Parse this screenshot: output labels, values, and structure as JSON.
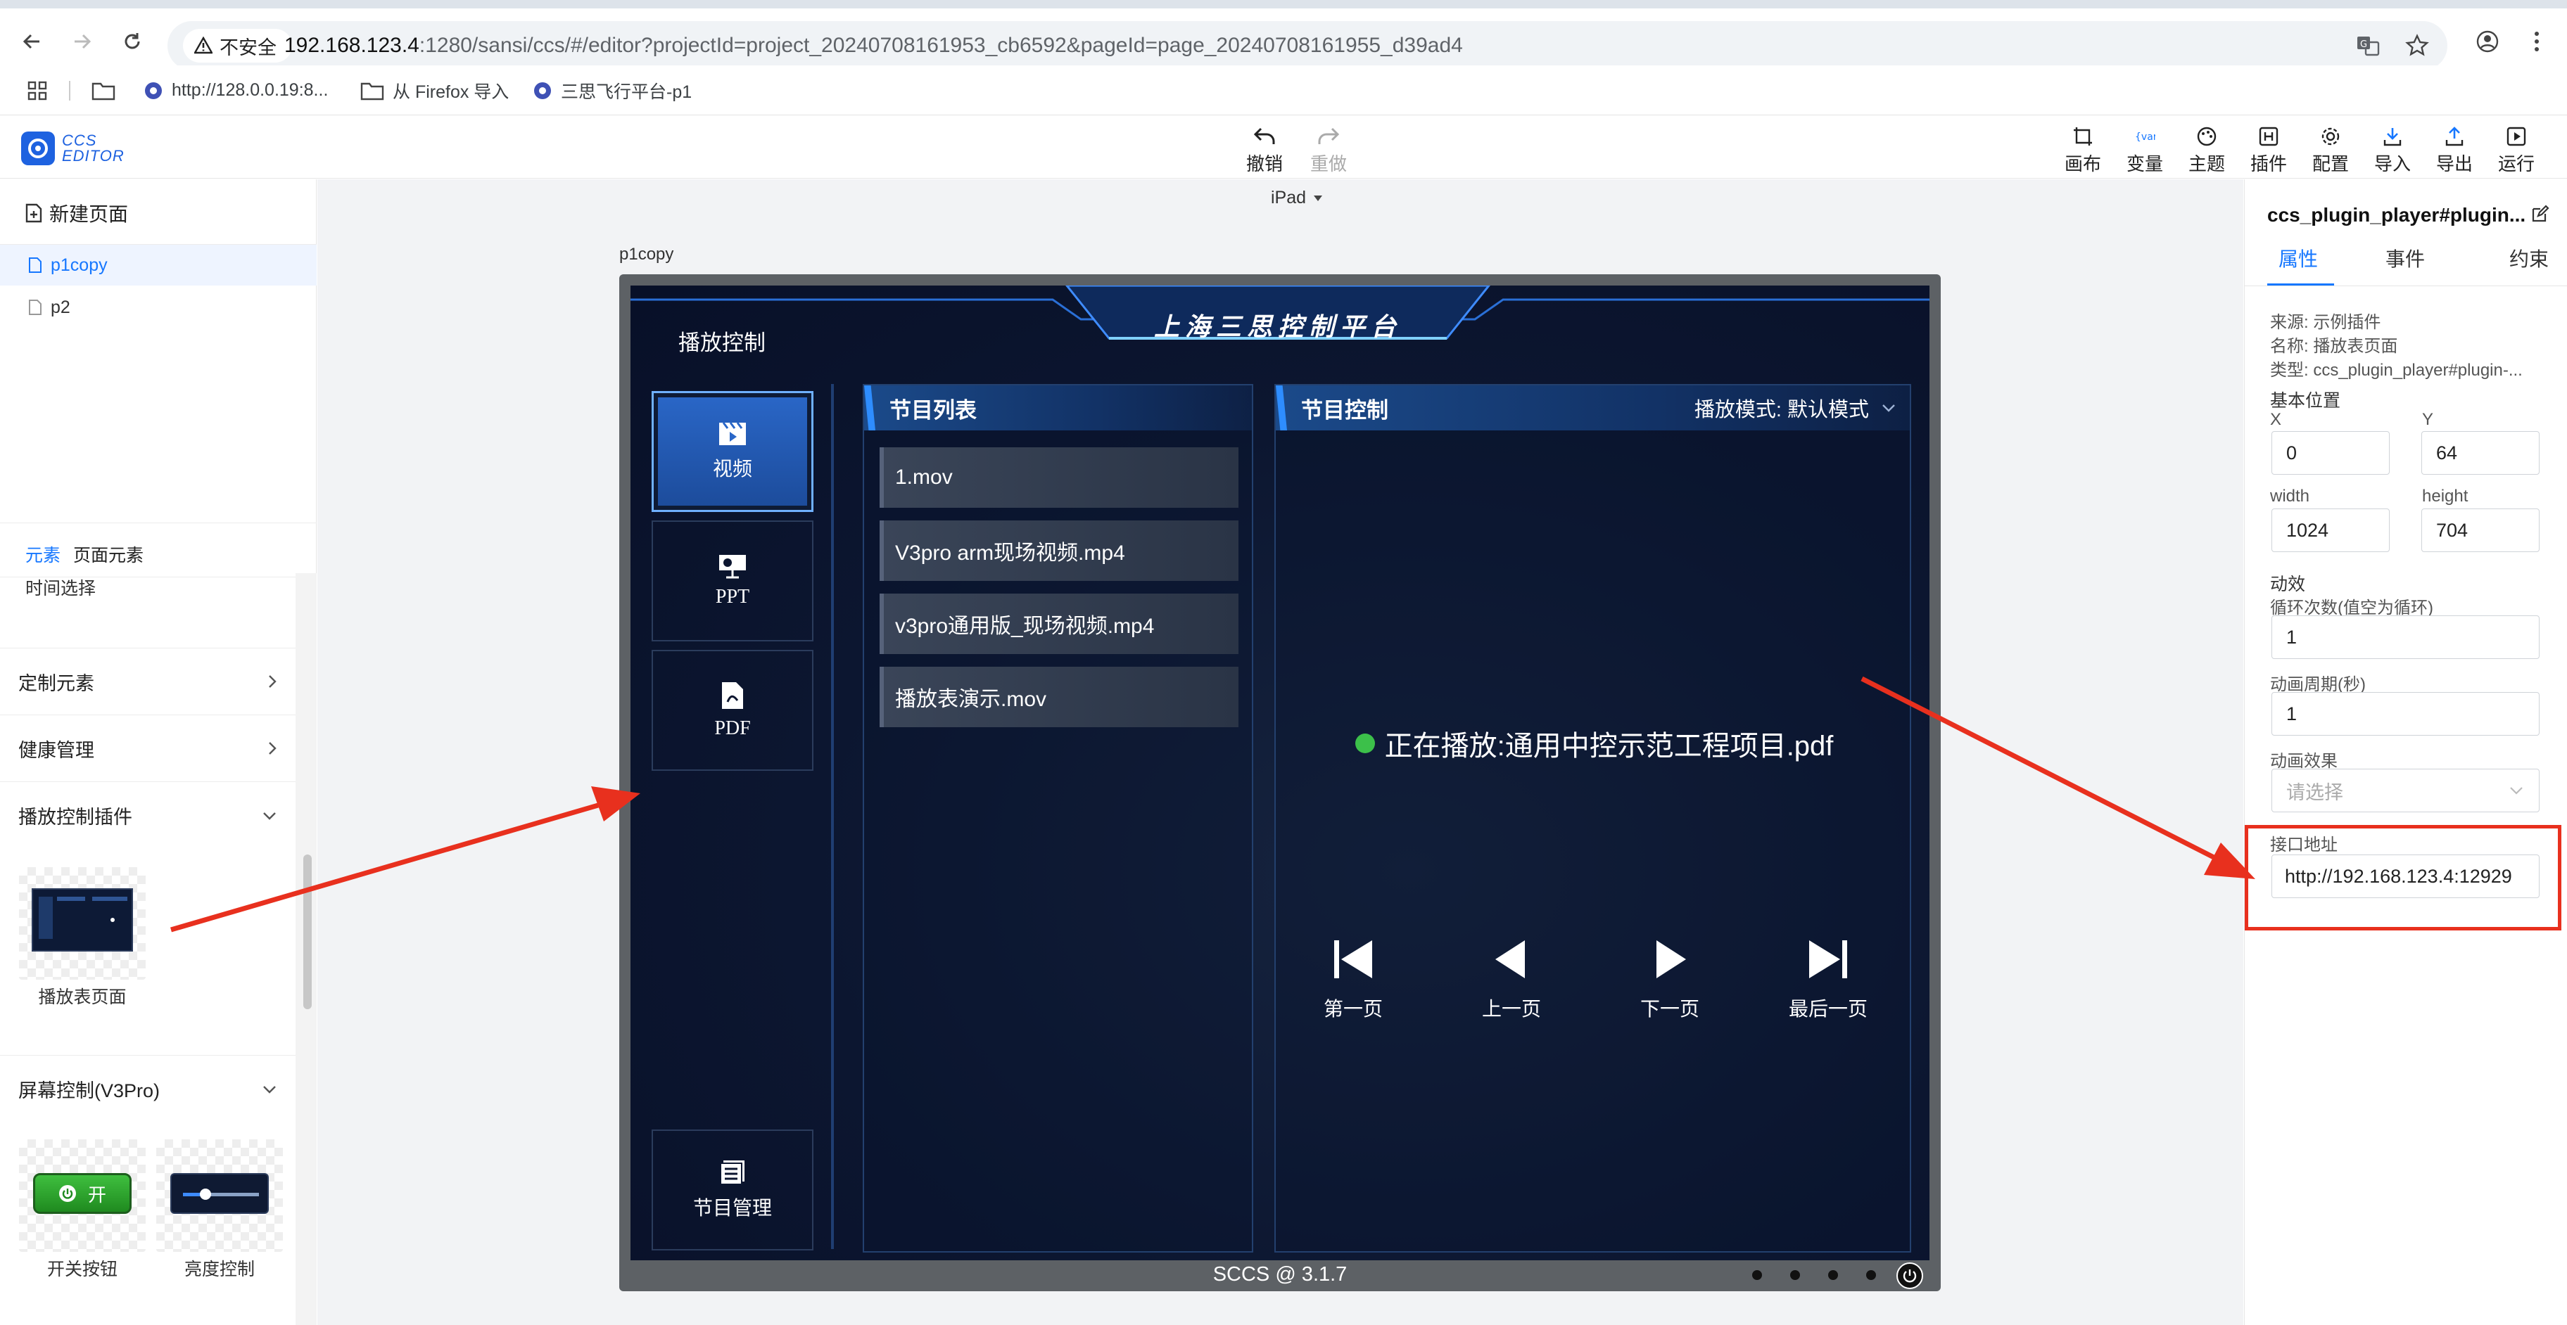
{
  "browser": {
    "security_label": "不安全",
    "url_host": "192.168.123.4",
    "url_rest": ":1280/sansi/ccs/#/editor?projectId=project_20240708161953_cb6592&pageId=page_20240708161955_d39ad4",
    "bookmarks": [
      {
        "label": "http://128.0.0.19:8..."
      },
      {
        "label": "从 Firefox 导入"
      },
      {
        "label": "三思飞行平台-p1"
      }
    ]
  },
  "app": {
    "logo_line1": "CCS",
    "logo_line2": "EDITOR",
    "undo_label": "撤销",
    "redo_label": "重做",
    "toolbar": [
      {
        "label": "画布",
        "icon": "canvas-icon"
      },
      {
        "label": "变量",
        "icon": "variable-icon"
      },
      {
        "label": "主题",
        "icon": "theme-icon"
      },
      {
        "label": "插件",
        "icon": "plugin-icon"
      },
      {
        "label": "配置",
        "icon": "settings-icon"
      },
      {
        "label": "导入",
        "icon": "import-icon"
      },
      {
        "label": "导出",
        "icon": "export-icon"
      },
      {
        "label": "运行",
        "icon": "run-icon"
      }
    ]
  },
  "left": {
    "new_page": "新建页面",
    "pages": [
      "p1copy",
      "p2"
    ],
    "tabs": [
      "元素",
      "页面元素"
    ],
    "truncated_item": "时间选择",
    "categories": [
      {
        "label": "定制元素",
        "expanded": false
      },
      {
        "label": "健康管理",
        "expanded": false
      },
      {
        "label": "播放控制插件",
        "expanded": true
      },
      {
        "label": "屏幕控制(V3Pro)",
        "expanded": true
      }
    ],
    "plugin_thumb_label": "播放表页面",
    "switch_label": "开关按钮",
    "switch_text": "开",
    "brightness_label": "亮度控制"
  },
  "canvas": {
    "device": "iPad",
    "page_label": "p1copy",
    "screen": {
      "title": "上海三思控制平台",
      "section_title": "播放控制",
      "nav": [
        "视频",
        "PPT",
        "PDF"
      ],
      "manage_label": "节目管理",
      "list_title": "节目列表",
      "files": [
        "1.mov",
        "V3pro arm现场视频.mp4",
        "v3pro通用版_现场视频.mp4",
        "播放表演示.mov"
      ],
      "control_title": "节目控制",
      "mode_label": "播放模式: 默认模式",
      "now_playing": "正在播放:通用中控示范工程项目.pdf",
      "controls": [
        "第一页",
        "上一页",
        "下一页",
        "最后一页"
      ],
      "footer": "SCCS @ 3.1.7",
      "status_color": "#3cc04a"
    }
  },
  "right": {
    "title": "ccs_plugin_player#plugin...",
    "tabs": [
      "属性",
      "事件",
      "约束"
    ],
    "source": "来源: 示例插件",
    "name": "名称: 播放表页面",
    "type": "类型: ccs_plugin_player#plugin-...",
    "basic_position": "基本位置",
    "x_label": "X",
    "x_value": "0",
    "y_label": "Y",
    "y_value": "64",
    "width_label": "width",
    "width_value": "1024",
    "height_label": "height",
    "height_value": "704",
    "animation": "动效",
    "loop_label": "循环次数(值空为循环)",
    "loop_value": "1",
    "period_label": "动画周期(秒)",
    "period_value": "1",
    "effect_label": "动画效果",
    "effect_placeholder": "请选择",
    "api_label": "接口地址",
    "api_value": "http://192.168.123.4:12929"
  },
  "colors": {
    "accent": "#1677ff",
    "annotation": "#e8301e"
  }
}
